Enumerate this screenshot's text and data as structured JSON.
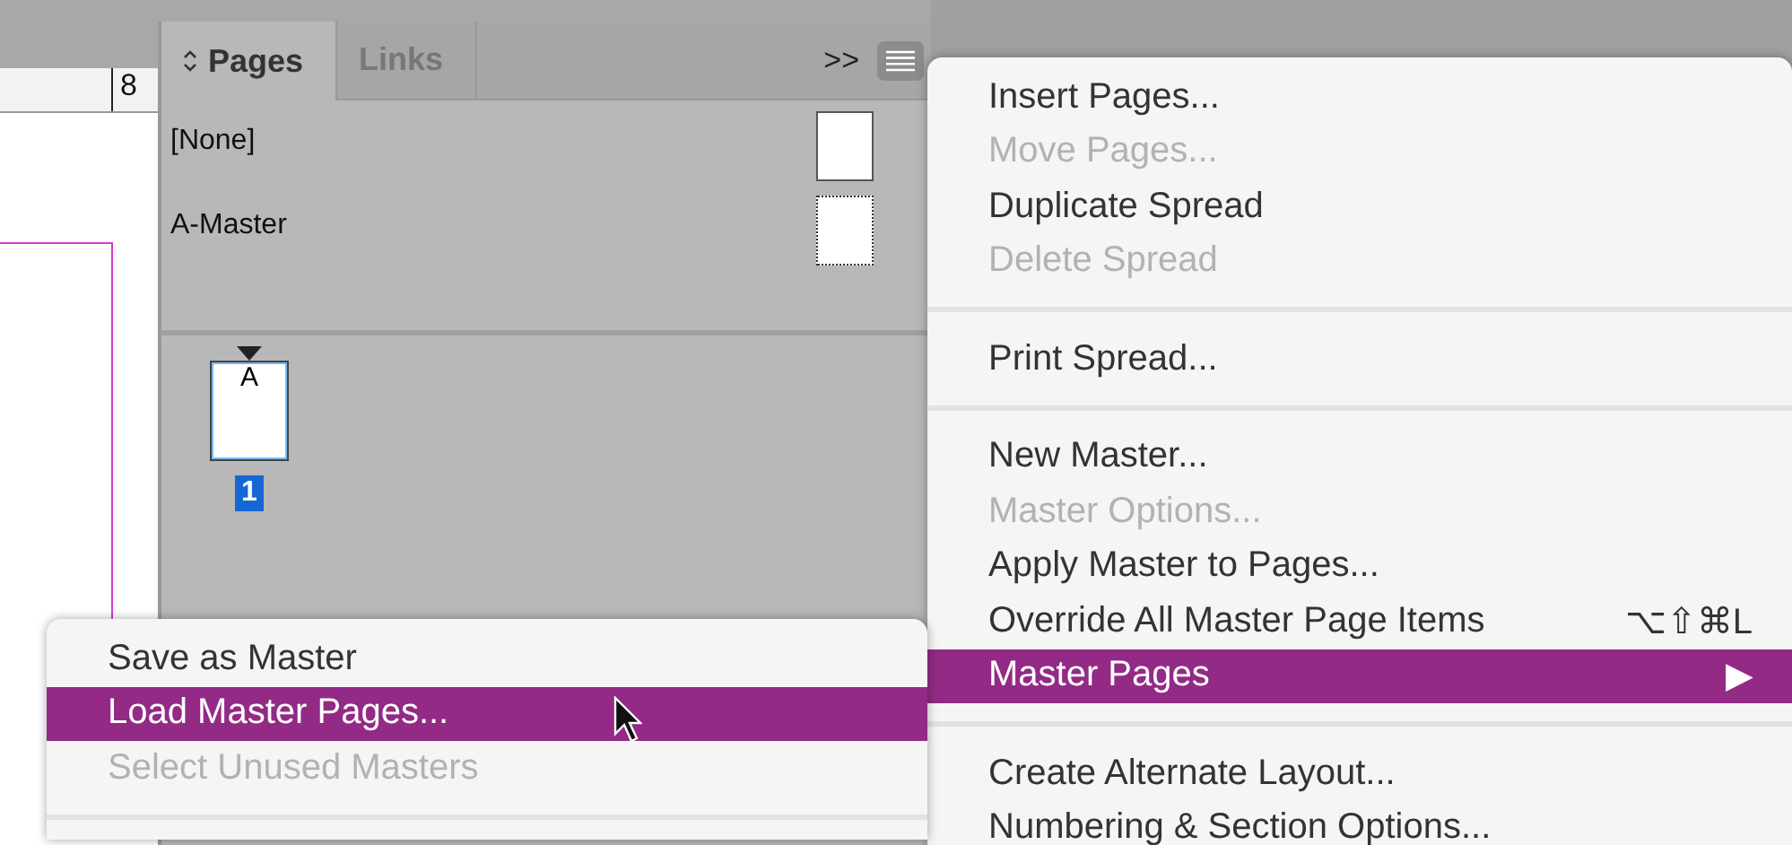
{
  "ruler": {
    "label": "8"
  },
  "panel": {
    "tabs": [
      {
        "label": "Pages",
        "selected": true
      },
      {
        "label": "Links",
        "selected": false
      }
    ],
    "overflow": ">>",
    "masters": [
      {
        "name": "[None]",
        "kind": "none"
      },
      {
        "name": "A-Master",
        "kind": "master"
      }
    ],
    "pages": [
      {
        "prefix": "A",
        "number": "1",
        "selected": true
      }
    ]
  },
  "menu": {
    "items": [
      {
        "kind": "item",
        "label": "Insert Pages...",
        "disabled": false,
        "selected": false
      },
      {
        "kind": "item",
        "label": "Move Pages...",
        "disabled": true,
        "selected": false
      },
      {
        "kind": "item",
        "label": "Duplicate Spread",
        "disabled": false,
        "selected": false
      },
      {
        "kind": "item",
        "label": "Delete Spread",
        "disabled": true,
        "selected": false
      },
      {
        "kind": "separator"
      },
      {
        "kind": "item",
        "label": "Print Spread...",
        "disabled": false,
        "selected": false
      },
      {
        "kind": "separator"
      },
      {
        "kind": "item",
        "label": "New Master...",
        "disabled": false,
        "selected": false
      },
      {
        "kind": "item",
        "label": "Master Options...",
        "disabled": true,
        "selected": false
      },
      {
        "kind": "item",
        "label": "Apply Master to Pages...",
        "disabled": false,
        "selected": false
      },
      {
        "kind": "item",
        "label": "Override All Master Page Items",
        "shortcut": "⌥⇧⌘L",
        "disabled": false,
        "selected": false
      },
      {
        "kind": "item",
        "label": "Master Pages",
        "submenu": "▶",
        "disabled": false,
        "selected": true
      },
      {
        "kind": "separator"
      },
      {
        "kind": "item",
        "label": "Create Alternate Layout...",
        "disabled": false,
        "selected": false
      },
      {
        "kind": "item",
        "label": "Numbering & Section Options...",
        "disabled": false,
        "selected": false
      }
    ]
  },
  "submenu": {
    "items": [
      {
        "kind": "item",
        "label": "Save as Master",
        "disabled": false,
        "selected": false
      },
      {
        "kind": "item",
        "label": "Load Master Pages...",
        "disabled": false,
        "selected": true
      },
      {
        "kind": "item",
        "label": "Select Unused Masters",
        "disabled": true,
        "selected": false
      },
      {
        "kind": "separator"
      }
    ]
  }
}
